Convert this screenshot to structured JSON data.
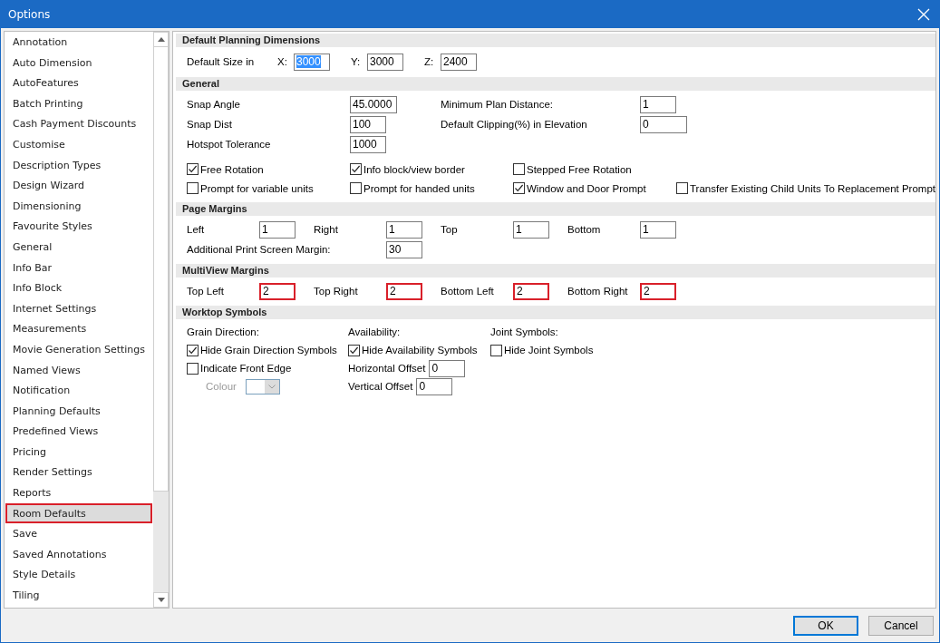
{
  "window": {
    "title": "Options"
  },
  "sidebar": {
    "items": [
      {
        "label": "Annotation",
        "selected": false,
        "highlighted": false
      },
      {
        "label": "Auto Dimension",
        "selected": false,
        "highlighted": false
      },
      {
        "label": "AutoFeatures",
        "selected": false,
        "highlighted": false
      },
      {
        "label": "Batch Printing",
        "selected": false,
        "highlighted": false
      },
      {
        "label": "Cash Payment Discounts",
        "selected": false,
        "highlighted": false
      },
      {
        "label": "Customise",
        "selected": false,
        "highlighted": false
      },
      {
        "label": "Description Types",
        "selected": false,
        "highlighted": false
      },
      {
        "label": "Design Wizard",
        "selected": false,
        "highlighted": false
      },
      {
        "label": "Dimensioning",
        "selected": false,
        "highlighted": false
      },
      {
        "label": "Favourite Styles",
        "selected": false,
        "highlighted": false
      },
      {
        "label": "General",
        "selected": false,
        "highlighted": false
      },
      {
        "label": "Info Bar",
        "selected": false,
        "highlighted": false
      },
      {
        "label": "Info Block",
        "selected": false,
        "highlighted": false
      },
      {
        "label": "Internet Settings",
        "selected": false,
        "highlighted": false
      },
      {
        "label": "Measurements",
        "selected": false,
        "highlighted": false
      },
      {
        "label": "Movie Generation Settings",
        "selected": false,
        "highlighted": false
      },
      {
        "label": "Named Views",
        "selected": false,
        "highlighted": false
      },
      {
        "label": "Notification",
        "selected": false,
        "highlighted": false
      },
      {
        "label": "Planning Defaults",
        "selected": false,
        "highlighted": false
      },
      {
        "label": "Predefined Views",
        "selected": false,
        "highlighted": false
      },
      {
        "label": "Pricing",
        "selected": false,
        "highlighted": false
      },
      {
        "label": "Render Settings",
        "selected": false,
        "highlighted": false
      },
      {
        "label": "Reports",
        "selected": false,
        "highlighted": false
      },
      {
        "label": "Room Defaults",
        "selected": true,
        "highlighted": true
      },
      {
        "label": "Save",
        "selected": false,
        "highlighted": false
      },
      {
        "label": "Saved Annotations",
        "selected": false,
        "highlighted": false
      },
      {
        "label": "Style Details",
        "selected": false,
        "highlighted": false
      },
      {
        "label": "Tiling",
        "selected": false,
        "highlighted": false
      }
    ]
  },
  "sections": [
    {
      "kind": "dimensions",
      "title": "Default Planning Dimensions",
      "label": "Default Size in",
      "fields": [
        {
          "label": "X:",
          "value": "3000",
          "selected": true
        },
        {
          "label": "Y:",
          "value": "3000",
          "selected": false
        },
        {
          "label": "Z:",
          "value": "2400",
          "selected": false
        }
      ]
    },
    {
      "kind": "general",
      "title": "General",
      "left_fields": [
        {
          "label": "Snap Angle",
          "value": "45.0000"
        },
        {
          "label": "Snap Dist",
          "value": "100"
        },
        {
          "label": "Hotspot Tolerance",
          "value": "1000"
        }
      ],
      "right_fields": [
        {
          "label": "Minimum Plan Distance:",
          "value": "1"
        },
        {
          "label": "Default Clipping(%) in Elevation",
          "value": "0"
        }
      ],
      "checkbox_rows": [
        [
          {
            "label": "Free Rotation",
            "checked": true
          },
          {
            "label": "Info block/view border",
            "checked": true
          },
          {
            "label": "Stepped Free Rotation",
            "checked": false
          }
        ],
        [
          {
            "label": "Prompt for variable units",
            "checked": false
          },
          {
            "label": "Prompt for handed units",
            "checked": false
          },
          {
            "label": "Window and Door Prompt",
            "checked": true
          },
          {
            "label": "Transfer Existing Child Units To Replacement Prompt",
            "checked": false
          }
        ]
      ]
    },
    {
      "kind": "margins",
      "title": "Page Margins",
      "fields": [
        {
          "label": "Left",
          "value": "1",
          "highlighted": false
        },
        {
          "label": "Right",
          "value": "1",
          "highlighted": false
        },
        {
          "label": "Top",
          "value": "1",
          "highlighted": false
        },
        {
          "label": "Bottom",
          "value": "1",
          "highlighted": false
        }
      ],
      "extra": {
        "label": "Additional Print Screen Margin:",
        "value": "30"
      }
    },
    {
      "kind": "margins",
      "title": "MultiView Margins",
      "fields": [
        {
          "label": "Top Left",
          "value": "2",
          "highlighted": true
        },
        {
          "label": "Top Right",
          "value": "2",
          "highlighted": true
        },
        {
          "label": "Bottom Left",
          "value": "2",
          "highlighted": true
        },
        {
          "label": "Bottom Right",
          "value": "2",
          "highlighted": true
        }
      ]
    },
    {
      "kind": "worktop",
      "title": "Worktop Symbols",
      "columns": [
        {
          "heading": "Grain Direction:",
          "items": [
            {
              "kind": "checkbox",
              "label": "Hide Grain Direction Symbols",
              "checked": true
            },
            {
              "kind": "checkbox",
              "label": "Indicate Front Edge",
              "checked": false
            },
            {
              "kind": "colour",
              "label": "Colour",
              "disabled": true
            }
          ]
        },
        {
          "heading": "Availability:",
          "items": [
            {
              "kind": "checkbox",
              "label": "Hide Availability Symbols",
              "checked": true
            },
            {
              "kind": "field",
              "label": "Horizontal Offset",
              "value": "0"
            },
            {
              "kind": "field",
              "label": "Vertical Offset",
              "value": "0"
            }
          ]
        },
        {
          "heading": "Joint Symbols:",
          "items": [
            {
              "kind": "checkbox",
              "label": "Hide Joint Symbols",
              "checked": false
            }
          ]
        }
      ]
    }
  ],
  "buttons": [
    {
      "label": "OK",
      "default": true
    },
    {
      "label": "Cancel",
      "default": false
    }
  ]
}
